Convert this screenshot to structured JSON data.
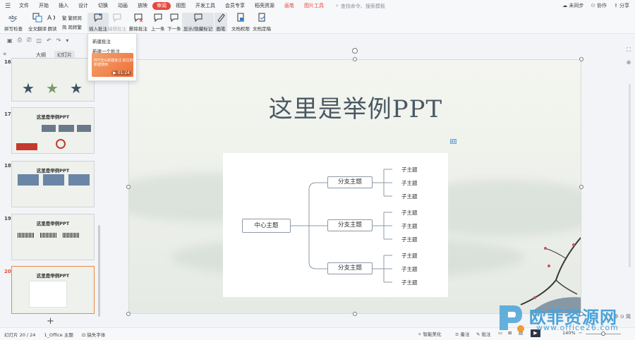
{
  "menu": {
    "items": [
      "文件",
      "开始",
      "插入",
      "设计",
      "切换",
      "动画",
      "放映",
      "审阅",
      "视图",
      "开发工具",
      "会员专享",
      "稻壳资源",
      "画笔",
      "图片工具"
    ],
    "active_index": 7,
    "red_indices": [
      12,
      13
    ],
    "search_placeholder": "查找命令、搜索模板",
    "right": {
      "sync": "未同步",
      "collab": "协作",
      "share": "分享"
    }
  },
  "ribbon": {
    "spellcheck": "拼写检查",
    "translate": "全文翻译",
    "read": "朗读",
    "trad_to_simp": "繁转简",
    "simp_to_trad": "简转繁",
    "insert_comment": "插入批注",
    "edit_comment": "编辑批注",
    "delete_comment": "删除批注",
    "prev": "上一条",
    "next": "下一条",
    "show_hide": "显示/隐藏标记",
    "pen": "画笔",
    "doc_rights": "文档权限",
    "doc_finalize": "文档定稿"
  },
  "dropdown": {
    "title": "新建批注",
    "item": "新建一个批注",
    "card_text": "PPT怎么新建批注 批注的新建使用",
    "duration": "01:24"
  },
  "left_panel": {
    "tab_outline": "大纲",
    "tab_slides": "幻灯片",
    "slides": [
      {
        "num": "16",
        "title": ""
      },
      {
        "num": "17",
        "title": "这里是举例PPT"
      },
      {
        "num": "18",
        "title": "这里是举例PPT"
      },
      {
        "num": "19",
        "title": "这里是举例PPT"
      },
      {
        "num": "20",
        "title": "这里是举例PPT"
      }
    ],
    "add": "+"
  },
  "slide": {
    "title": "这里是举例PPT",
    "center": "中心主题",
    "branches": [
      {
        "label": "分支主题",
        "leaves": [
          "子主题",
          "子主题",
          "子主题"
        ]
      },
      {
        "label": "分支主题",
        "leaves": [
          "子主题",
          "子主题",
          "子主题"
        ]
      },
      {
        "label": "分支主题",
        "leaves": [
          "子主题",
          "子主题",
          "子主题"
        ]
      }
    ],
    "comment_badge": "a1"
  },
  "status": {
    "slide_pos": "幻灯片 20 / 24",
    "theme": "1_Office 主题",
    "missing_font": "缺失字体",
    "smart_beautify": "智能美化",
    "notes": "备注",
    "annotate": "批注",
    "zoom": "140%",
    "zh": "中 ⊙ 简"
  },
  "watermark": {
    "cn": "欧菲资源网",
    "en": "www.office26.com"
  }
}
